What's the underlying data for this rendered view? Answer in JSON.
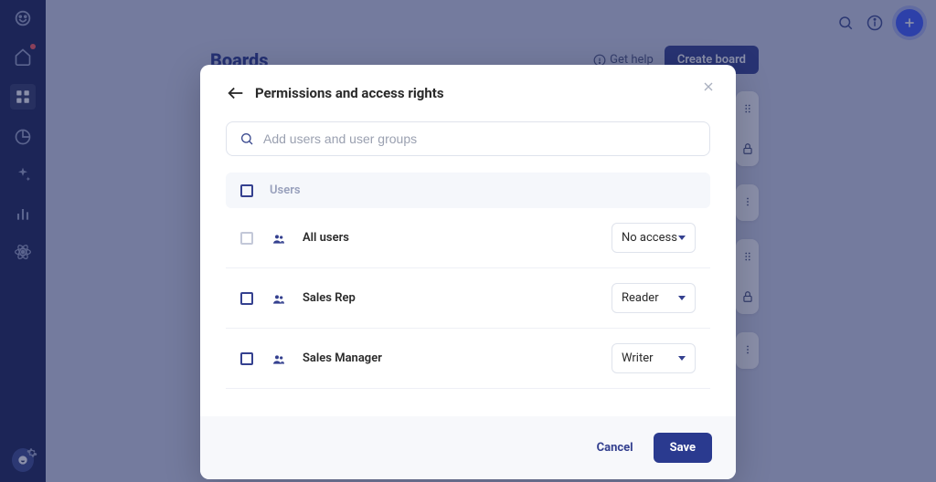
{
  "page": {
    "title": "Boards"
  },
  "topbar": {
    "help_label": "Get help",
    "create_label": "Create board"
  },
  "modal": {
    "title": "Permissions and access rights",
    "search_placeholder": "Add users and user groups",
    "table_header": "Users",
    "rows": [
      {
        "name": "All users",
        "role": "No access",
        "checkbox_style": "light"
      },
      {
        "name": "Sales Rep",
        "role": "Reader",
        "checkbox_style": "dark"
      },
      {
        "name": "Sales Manager",
        "role": "Writer",
        "checkbox_style": "dark"
      }
    ],
    "cancel_label": "Cancel",
    "save_label": "Save"
  }
}
